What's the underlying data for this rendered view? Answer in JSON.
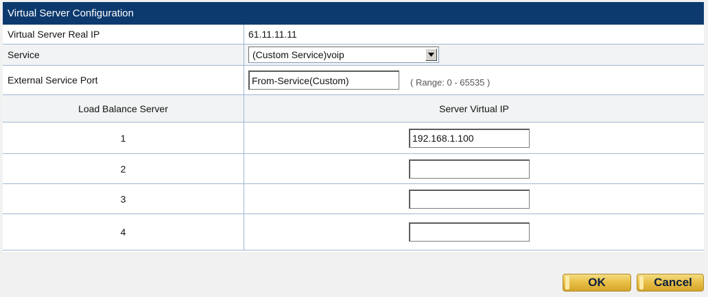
{
  "header": {
    "title": "Virtual Server Configuration"
  },
  "real_ip": {
    "label": "Virtual Server Real IP",
    "value": "61.11.11.11"
  },
  "service": {
    "label": "Service",
    "selected": "(Custom Service)voip"
  },
  "external_port": {
    "label": "External Service Port",
    "value": "From-Service(Custom)",
    "range_note": "( Range: 0 - 65535 )"
  },
  "table": {
    "col1": "Load Balance Server",
    "col2": "Server Virtual IP",
    "rows": [
      {
        "index": "1",
        "ip": "192.168.1.100"
      },
      {
        "index": "2",
        "ip": ""
      },
      {
        "index": "3",
        "ip": ""
      },
      {
        "index": "4",
        "ip": ""
      }
    ]
  },
  "buttons": {
    "ok": "OK",
    "cancel": "Cancel"
  },
  "colors": {
    "header_bg": "#0c3a6e",
    "button_gold": "#e8be45",
    "border": "#9db8d2"
  }
}
